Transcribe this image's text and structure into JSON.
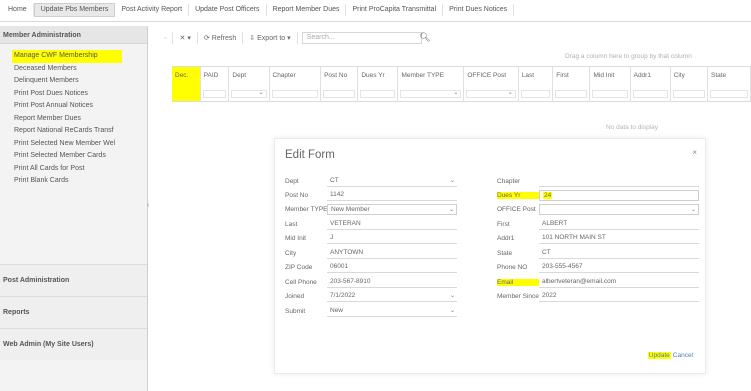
{
  "topbar": {
    "items": [
      "Home",
      "Update Pbs Members",
      "Post Activity Report",
      "Update Post Officers",
      "Report Member Dues",
      "Print ProCapita Transmittal",
      "Print Dues Notices"
    ],
    "active_index": 1
  },
  "sidebar": {
    "header": "Member Administration",
    "items": [
      "Manage CWF Membership",
      "Deceased Members",
      "Delinquent Members",
      "Print Post Dues Notices",
      "Print Post Annual Notices",
      "Report Member Dues",
      "Report National ReCards Transf",
      "Print Selected New Member Wel",
      "Print Selected Member Cards",
      "Print All Cards for Post",
      "Print Blank Cards"
    ],
    "highlight_index": 0,
    "sections": [
      "Post Administration",
      "Reports",
      "Web Admin (My Site Users)"
    ]
  },
  "toolbar": {
    "refresh_label": "Refresh",
    "export_label": "Export to",
    "search_placeholder": "Search..."
  },
  "grid": {
    "group_hint": "Drag a column here to group by that column",
    "columns": [
      {
        "label": "Dec.",
        "hl": true,
        "w": 20,
        "filter": false
      },
      {
        "label": "PAID",
        "w": 20,
        "filter": true
      },
      {
        "label": "Dept",
        "w": 28,
        "filter": true,
        "dropdown": true
      },
      {
        "label": "Chapter",
        "w": 36,
        "filter": true
      },
      {
        "label": "Post No",
        "w": 26,
        "filter": true
      },
      {
        "label": "Dues Yr",
        "w": 28,
        "filter": true
      },
      {
        "label": "Member TYPE",
        "w": 46,
        "filter": true,
        "dropdown": true
      },
      {
        "label": "OFFICE Post",
        "w": 38,
        "filter": true,
        "dropdown": true
      },
      {
        "label": "Last",
        "w": 24,
        "filter": true
      },
      {
        "label": "First",
        "w": 26,
        "filter": true
      },
      {
        "label": "Mid Init",
        "w": 28,
        "filter": true
      },
      {
        "label": "Addr1",
        "w": 28,
        "filter": true
      },
      {
        "label": "City",
        "w": 26,
        "filter": true
      },
      {
        "label": "State",
        "w": 30,
        "filter": true
      }
    ],
    "norecords": "No data to display"
  },
  "dialog": {
    "title": "Edit Form",
    "close_icon": "×",
    "left_fields": [
      {
        "label": "Dept",
        "value": "CT",
        "dropdown": true
      },
      {
        "label": "Post No",
        "value": "1142"
      },
      {
        "label": "Member TYPE",
        "value": "New Member",
        "dropdown": true,
        "boxed": true
      },
      {
        "label": "Last",
        "value": "VETERAN"
      },
      {
        "label": "Mid Init",
        "value": "J"
      },
      {
        "label": "City",
        "value": "ANYTOWN"
      },
      {
        "label": "ZIP Code",
        "value": "06001"
      },
      {
        "label": "Cell Phone",
        "value": "203-567-8910"
      },
      {
        "label": "Joined",
        "value": "7/1/2022",
        "dropdown": true
      },
      {
        "label": "Submit",
        "value": "New",
        "dropdown": true
      }
    ],
    "right_fields": [
      {
        "label": "Chapter",
        "value": ""
      },
      {
        "label": "Dues Yr",
        "value": "24",
        "hl_label": true,
        "hl_value": true,
        "boxed": true
      },
      {
        "label": "OFFICE Post",
        "value": "",
        "dropdown": true,
        "boxed": true
      },
      {
        "label": "First",
        "value": "ALBERT"
      },
      {
        "label": "Addr1",
        "value": "101 NORTH MAIN ST"
      },
      {
        "label": "State",
        "value": "CT"
      },
      {
        "label": "Phone NO",
        "value": "203-555-4567"
      },
      {
        "label": "Email",
        "value": "albertveteran@email.com",
        "hl_label": true
      },
      {
        "label": "Member Since",
        "value": "2022"
      }
    ],
    "update_label": "Update",
    "cancel_label": "Cancel"
  }
}
